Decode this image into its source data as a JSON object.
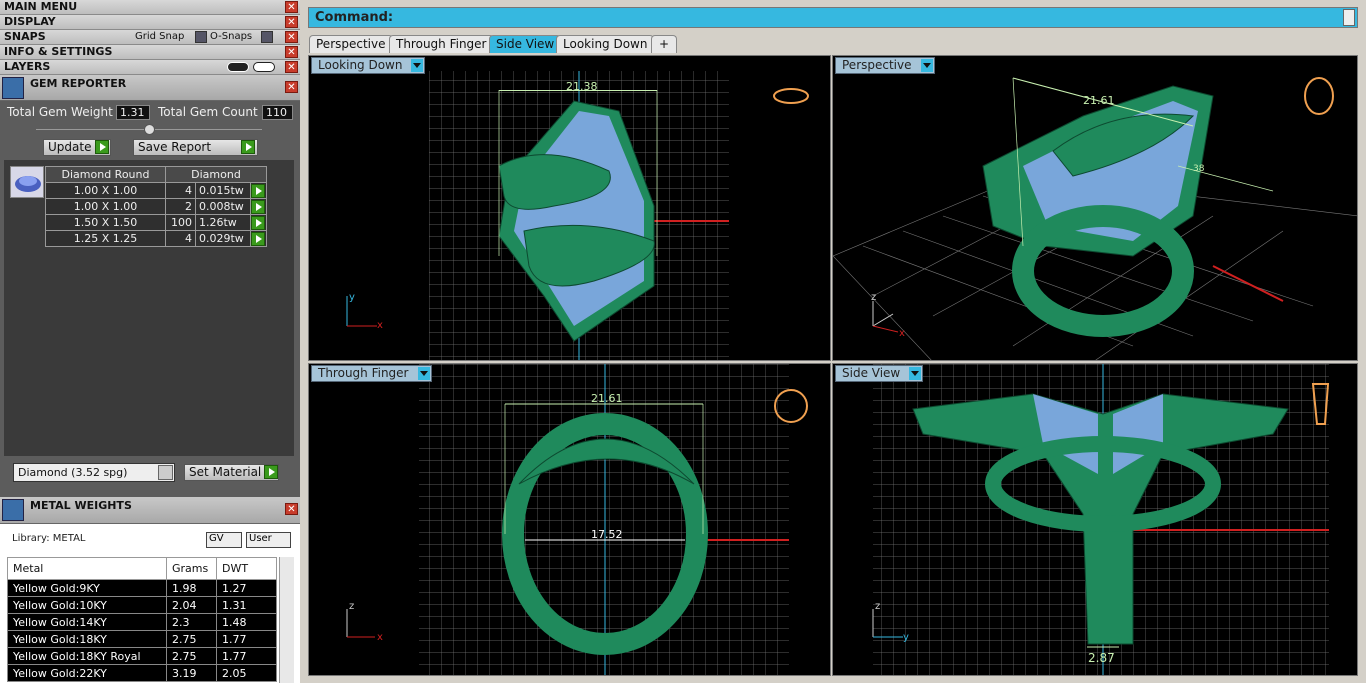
{
  "menus": {
    "main_menu": "MAIN MENU",
    "display": "DISPLAY",
    "snaps": "SNAPS",
    "grid_snap": "Grid Snap",
    "o_snaps": "O-Snaps",
    "info_settings": "INFO & SETTINGS",
    "layers": "LAYERS"
  },
  "gem_reporter": {
    "title": "GEM REPORTER",
    "total_weight_label": "Total Gem Weight",
    "total_weight": "1.31",
    "total_count_label": "Total Gem Count",
    "total_count": "110",
    "update_label": "Update",
    "save_report_label": "Save Report",
    "col_shape": "Diamond Round",
    "col_material": "Diamond",
    "rows": [
      {
        "size": "1.00 X 1.00",
        "count": "4",
        "weight": "0.015tw"
      },
      {
        "size": "1.00 X 1.00",
        "count": "2",
        "weight": "0.008tw"
      },
      {
        "size": "1.50 X 1.50",
        "count": "100",
        "weight": "1.26tw"
      },
      {
        "size": "1.25 X 1.25",
        "count": "4",
        "weight": "0.029tw"
      }
    ],
    "material_select": "Diamond     (3.52 spg)",
    "set_material_label": "Set Material"
  },
  "metal_weights": {
    "title": "METAL WEIGHTS",
    "library": "Library: METAL",
    "gv_label": "GV",
    "user_label": "User",
    "headers": [
      "Metal",
      "Grams",
      "DWT"
    ],
    "rows": [
      [
        "Yellow Gold:9KY",
        "1.98",
        "1.27"
      ],
      [
        "Yellow Gold:10KY",
        "2.04",
        "1.31"
      ],
      [
        "Yellow Gold:14KY",
        "2.3",
        "1.48"
      ],
      [
        "Yellow Gold:18KY",
        "2.75",
        "1.77"
      ],
      [
        "Yellow Gold:18KY Royal",
        "2.75",
        "1.77"
      ],
      [
        "Yellow Gold:22KY",
        "3.19",
        "2.05"
      ]
    ]
  },
  "command": {
    "label": "Command:"
  },
  "tabs": [
    "Perspective",
    "Through Finger",
    "Side View",
    "Looking Down",
    "+"
  ],
  "active_tab": "Side View",
  "viewports": {
    "top_left": {
      "name": "Looking Down",
      "dimension": "21.38"
    },
    "top_right": {
      "name": "Perspective",
      "dimension": "21.61",
      "dimension2": "38"
    },
    "bottom_left": {
      "name": "Through Finger",
      "dimension": "21.61",
      "inner": "17.52"
    },
    "bottom_right": {
      "name": "Side View",
      "dimension": "2.87"
    }
  },
  "colors": {
    "accent": "#36b8e0",
    "model": "#1f8a5c",
    "gem": "#8aaaf0",
    "grid": "#888888",
    "dim": "#c8f0b0"
  }
}
